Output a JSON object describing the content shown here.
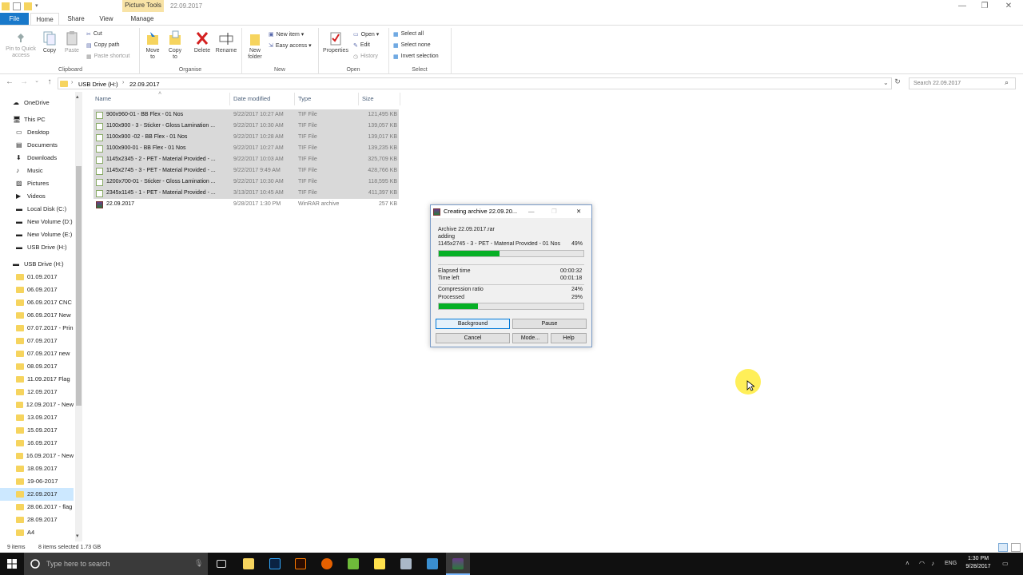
{
  "window": {
    "title": "22.09.2017",
    "contextual_tab": "Picture Tools",
    "minimize": "—",
    "maximize": "❐",
    "close": "✕"
  },
  "tabs": [
    "File",
    "Home",
    "Share",
    "View",
    "Manage"
  ],
  "ribbon": {
    "pin": "Pin to Quick access",
    "copy": "Copy",
    "paste": "Paste",
    "cut": "Cut",
    "copy_path": "Copy path",
    "paste_shortcut": "Paste shortcut",
    "move_to": "Move to",
    "copy_to": "Copy to",
    "delete": "Delete",
    "rename": "Rename",
    "new_folder": "New folder",
    "new_item": "New item ▾",
    "easy_access": "Easy access ▾",
    "properties": "Properties",
    "open": "Open ▾",
    "edit": "Edit",
    "history": "History",
    "select_all": "Select all",
    "select_none": "Select none",
    "invert_selection": "Invert selection",
    "groups": [
      "Clipboard",
      "Organise",
      "New",
      "Open",
      "Select"
    ]
  },
  "address": {
    "crumbs": [
      "USB Drive (H:)",
      "22.09.2017"
    ],
    "separator": "›",
    "search_placeholder": "Search 22.09.2017"
  },
  "nav": {
    "top": [
      "OneDrive",
      "This PC"
    ],
    "thispc": [
      "Desktop",
      "Documents",
      "Downloads",
      "Music",
      "Pictures",
      "Videos",
      "Local Disk (C:)",
      "New Volume (D:)",
      "New Volume (E:)",
      "USB Drive (H:)"
    ],
    "usb_root": "USB Drive (H:)",
    "folders": [
      "01.09.2017",
      "06.09.2017",
      "06.09.2017 CNC",
      "06.09.2017 New",
      "07.07.2017 - Prin",
      "07.09.2017",
      "07.09.2017 new",
      "08.09.2017",
      "11.09.2017 Flag",
      "12.09.2017",
      "12.09.2017 - New",
      "13.09.2017",
      "15.09.2017",
      "16.09.2017",
      "16.09.2017 - New",
      "18.09.2017",
      "19-06-2017",
      "22.09.2017",
      "28.06.2017 - flag",
      "28.09.2017",
      "A4"
    ],
    "selected": "22.09.2017"
  },
  "columns": [
    "Name",
    "Date modified",
    "Type",
    "Size"
  ],
  "files": [
    {
      "name": "900x960-01 - BB Flex - 01 Nos",
      "date": "9/22/2017 10:27 AM",
      "type": "TIF File",
      "size": "121,495 KB",
      "selected": true
    },
    {
      "name": "1100x900 - 3 - Sticker - Gloss Lamination ...",
      "date": "9/22/2017 10:30 AM",
      "type": "TIF File",
      "size": "139,057 KB",
      "selected": true
    },
    {
      "name": "1100x900 -02 - BB Flex - 01 Nos",
      "date": "9/22/2017 10:28 AM",
      "type": "TIF File",
      "size": "139,017 KB",
      "selected": true
    },
    {
      "name": "1100x900-01 - BB Flex - 01 Nos",
      "date": "9/22/2017 10:27 AM",
      "type": "TIF File",
      "size": "139,235 KB",
      "selected": true
    },
    {
      "name": "1145x2345 - 2 - PET - Material Provided - ...",
      "date": "9/22/2017 10:03 AM",
      "type": "TIF File",
      "size": "325,709 KB",
      "selected": true
    },
    {
      "name": "1145x2745 - 3 - PET - Material Provided - ...",
      "date": "9/22/2017 9:49 AM",
      "type": "TIF File",
      "size": "428,766 KB",
      "selected": true
    },
    {
      "name": "1200x700-01 - Sticker - Gloss Lamination ...",
      "date": "9/22/2017 10:30 AM",
      "type": "TIF File",
      "size": "118,595 KB",
      "selected": true
    },
    {
      "name": "2345x1145 - 1 - PET - Material Provided - ...",
      "date": "3/13/2017 10:45 AM",
      "type": "TIF File",
      "size": "411,397 KB",
      "selected": true
    },
    {
      "name": "22.09.2017",
      "date": "9/28/2017 1:30 PM",
      "type": "WinRAR archive",
      "size": "257 KB",
      "selected": false
    }
  ],
  "status": {
    "items": "9 items",
    "selected": "8 items selected  1.73 GB"
  },
  "dialog": {
    "title": "Creating archive 22.09.20...",
    "archive": "Archive 22.09.2017.rar",
    "action": "adding",
    "current_file": "1145x2745 - 3 - PET - Material Provided - 01 Nos",
    "file_percent": "49%",
    "file_progress": 0.42,
    "elapsed_label": "Elapsed time",
    "elapsed": "00:00:32",
    "left_label": "Time left",
    "left": "00:01:18",
    "ratio_label": "Compression ratio",
    "ratio": "24%",
    "processed_label": "Processed",
    "processed": "29%",
    "processed_progress": 0.27,
    "buttons": {
      "background": "Background",
      "pause": "Pause",
      "cancel": "Cancel",
      "mode": "Mode...",
      "help": "Help"
    }
  },
  "taskbar": {
    "search": "Type here to search",
    "lang": "ENG",
    "time": "1:30 PM",
    "date": "9/28/2017"
  }
}
